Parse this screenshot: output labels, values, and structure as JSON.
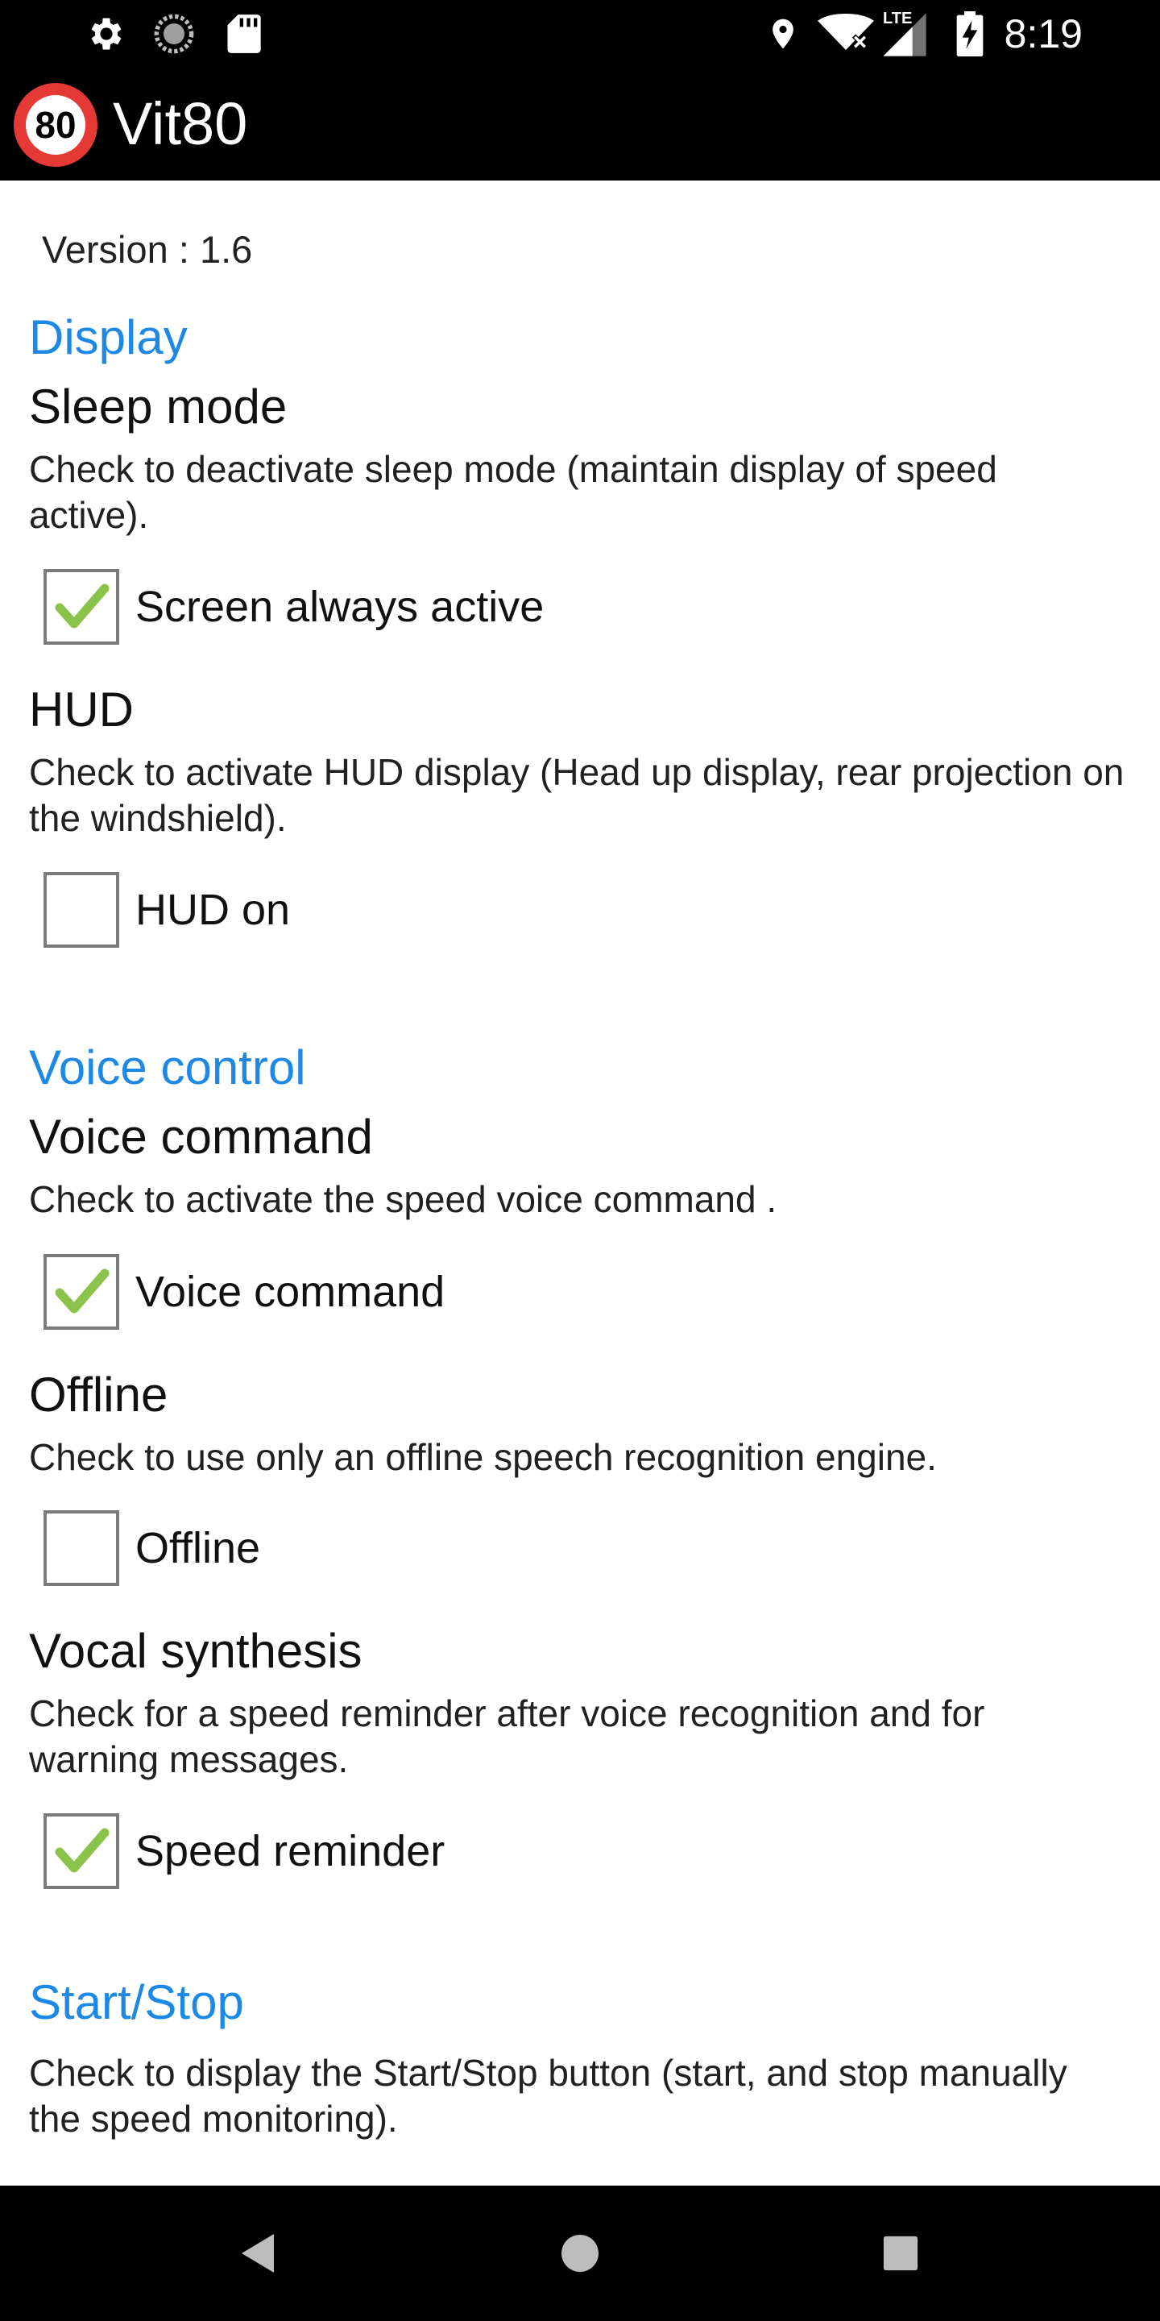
{
  "status_bar": {
    "time": "8:19",
    "network_label": "LTE",
    "icons": [
      "gear-icon",
      "sync-icon",
      "sd-card-icon",
      "location-icon",
      "wifi-icon",
      "signal-icon",
      "battery-charging-icon"
    ]
  },
  "app_bar": {
    "logo_text": "80",
    "title": "Vit80"
  },
  "version": "Version : 1.6",
  "sections": {
    "display": {
      "header": "Display",
      "sleep_mode": {
        "title": "Sleep mode",
        "summary": "Check to deactivate sleep mode (maintain display of speed active).",
        "checkbox_label": "Screen always active",
        "checked": true
      },
      "hud": {
        "title": "HUD",
        "summary": "Check to activate HUD display (Head up display, rear projection on the windshield).",
        "checkbox_label": "HUD on",
        "checked": false
      }
    },
    "voice_control": {
      "header": "Voice control",
      "voice_command": {
        "title": "Voice command",
        "summary": "Check to activate the speed voice command .",
        "checkbox_label": "Voice command",
        "checked": true
      },
      "offline": {
        "title": "Offline",
        "summary": "Check to use only an offline speech recognition engine.",
        "checkbox_label": "Offline",
        "checked": false
      },
      "vocal_synthesis": {
        "title": "Vocal synthesis",
        "summary": "Check for a speed reminder after voice recognition and for warning messages.",
        "checkbox_label": "Speed reminder",
        "checked": true
      }
    },
    "start_stop": {
      "header": "Start/Stop",
      "summary": "Check to display the Start/Stop button (start, and stop manually the speed monitoring)."
    }
  },
  "nav_bar": {
    "icons": [
      "back-icon",
      "home-icon",
      "recents-icon"
    ]
  },
  "colors": {
    "accent": "#1e88e5",
    "check": "#8bc34a",
    "logo_ring": "#e53935"
  }
}
